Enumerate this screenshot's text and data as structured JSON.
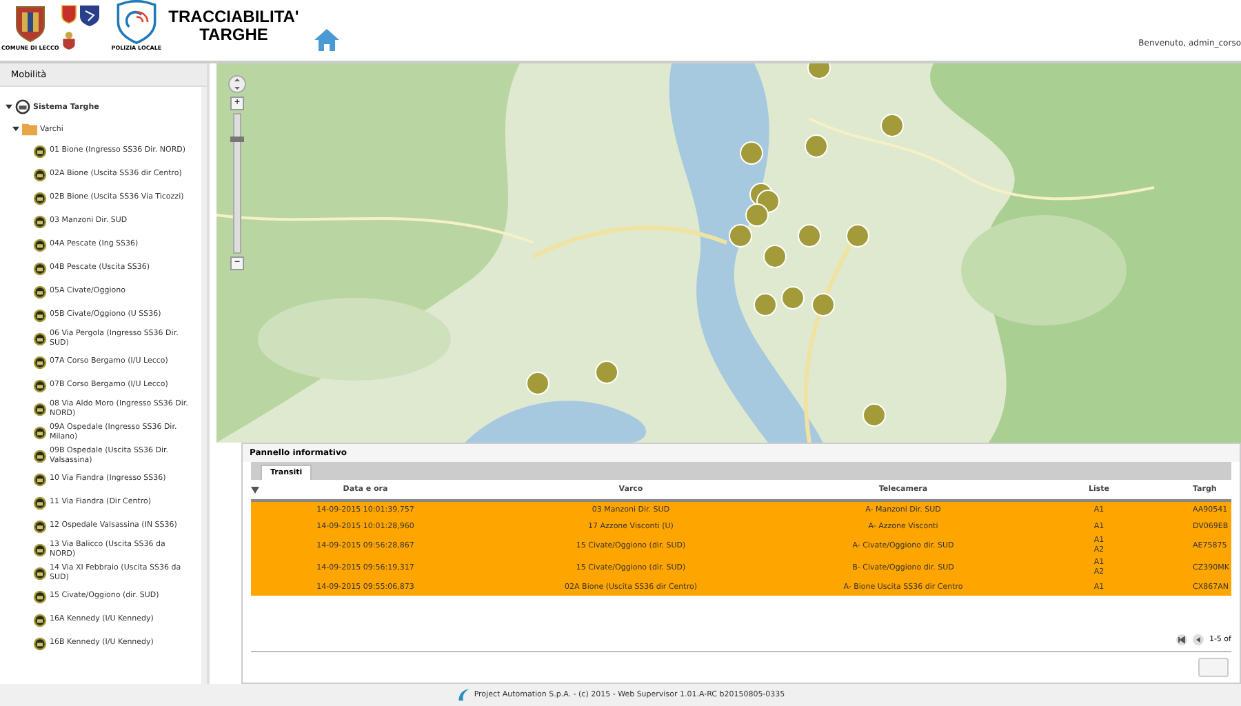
{
  "header": {
    "logo_caption_left": "COMUNE DI LECCO",
    "logo_caption_right": "POLIZIA LOCALE",
    "title_line_1": "TRACCIABILITA'",
    "title_line_2": "TARGHE",
    "welcome": "Benvenuto, admin_corso"
  },
  "sidebar": {
    "title": "Mobilità",
    "tree": [
      {
        "label": "Sistema Targhe",
        "expanded": true,
        "children": [
          {
            "label": "Varchi",
            "expanded": true,
            "children": [
              {
                "label": "01 Bione (Ingresso SS36 Dir. NORD)"
              },
              {
                "label": "02A Bione (Uscita SS36 dir Centro)"
              },
              {
                "label": "02B Bione (Uscita SS36 Via Ticozzi)"
              },
              {
                "label": "03 Manzoni Dir. SUD"
              },
              {
                "label": "04A Pescate (Ing SS36)"
              },
              {
                "label": "04B Pescate (Uscita SS36)"
              },
              {
                "label": "05A Civate/Oggiono"
              },
              {
                "label": "05B Civate/Oggiono (U SS36)"
              },
              {
                "label": "06 Via Pergola (Ingresso SS36 Dir. SUD)"
              },
              {
                "label": "07A Corso Bergamo (I/U Lecco)"
              },
              {
                "label": "07B Corso Bergamo (I/U Lecco)"
              },
              {
                "label": "08 Via Aldo Moro (Ingresso SS36 Dir. NORD)"
              },
              {
                "label": "09A Ospedale (Ingresso SS36 Dir. Milano)"
              },
              {
                "label": "09B Ospedale (Uscita SS36 Dir. Valsassina)"
              },
              {
                "label": "10 Via Fiandra (Ingresso SS36)"
              },
              {
                "label": "11 Via Fiandra (Dir Centro)"
              },
              {
                "label": "12 Ospedale Valsassina (IN SS36)"
              },
              {
                "label": "13 Via Balicco (Uscita SS36 da NORD)"
              },
              {
                "label": "14 Via XI Febbraio (Uscita SS36 da SUD)"
              },
              {
                "label": "15 Civate/Oggiono (dir. SUD)"
              },
              {
                "label": "16A Kennedy (I/U Kennedy)"
              },
              {
                "label": "16B Kennedy (I/U Kennedy)"
              }
            ]
          }
        ]
      }
    ]
  },
  "map": {
    "zoom_in": "+",
    "zoom_out": "−",
    "level": 0.82
  },
  "info_panel": {
    "title": "Pannello informativo",
    "tabs": [
      {
        "label": "Transiti",
        "selected": true
      }
    ],
    "table": {
      "columns": [
        "Data e ora",
        "Varco",
        "Telecamera",
        "Liste",
        "Targh"
      ],
      "rows": [
        {
          "cells": [
            "14-09-2015 10:01:39,757",
            "03 Manzoni Dir. SUD",
            "A- Manzoni Dir. SUD",
            [
              "A1"
            ],
            "AA90541"
          ]
        },
        {
          "cells": [
            "14-09-2015 10:01:28,960",
            "17 Azzone Visconti (U)",
            "A- Azzone Visconti",
            [
              "A1"
            ],
            "DV069EB"
          ]
        },
        {
          "cells": [
            "14-09-2015 09:56:28,867",
            "15 Civate/Oggiono (dir. SUD)",
            "A- Civate/Oggiono dir. SUD",
            [
              "A1",
              "A2"
            ],
            "AE75875"
          ]
        },
        {
          "cells": [
            "14-09-2015 09:56:19,317",
            "15 Civate/Oggiono (dir. SUD)",
            "B- Civate/Oggiono dir. SUD",
            [
              "A1",
              "A2"
            ],
            "CZ390MK"
          ]
        },
        {
          "cells": [
            "14-09-2015 09:55:06,873",
            "02A Bione (Uscita SS36 dir Centro)",
            "A- Bione Uscita SS36 dir Centro",
            [
              "A1"
            ],
            "CX867AN"
          ]
        }
      ]
    },
    "pager": "1-5 of"
  },
  "footer": "Project Automation S.p.A. - (c) 2015 - Web Supervisor 1.01.A-RC b20150805-0335"
}
